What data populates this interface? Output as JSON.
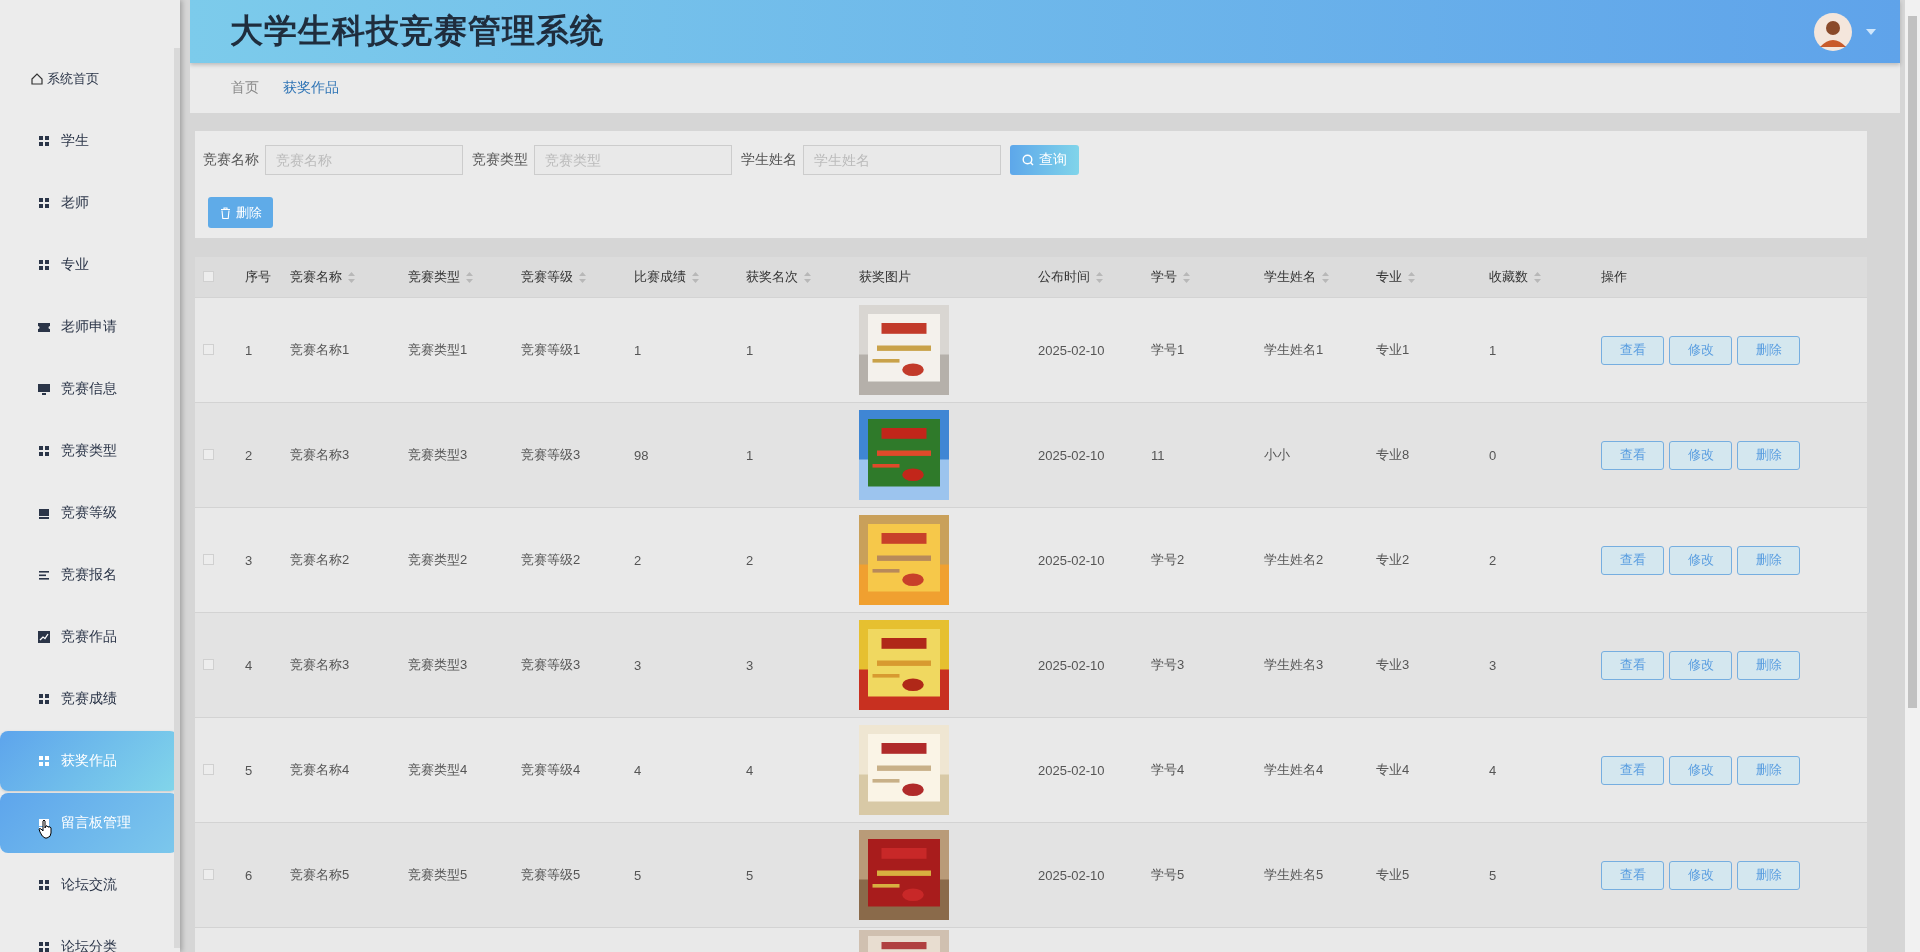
{
  "sidebar": {
    "items": [
      {
        "label": "系统首页",
        "selected": false,
        "hovered": false
      },
      {
        "label": "学生",
        "selected": false,
        "hovered": false
      },
      {
        "label": "老师",
        "selected": false,
        "hovered": false
      },
      {
        "label": "专业",
        "selected": false,
        "hovered": false
      },
      {
        "label": "老师申请",
        "selected": false,
        "hovered": false
      },
      {
        "label": "竞赛信息",
        "selected": false,
        "hovered": false
      },
      {
        "label": "竞赛类型",
        "selected": false,
        "hovered": false
      },
      {
        "label": "竞赛等级",
        "selected": false,
        "hovered": false
      },
      {
        "label": "竞赛报名",
        "selected": false,
        "hovered": false
      },
      {
        "label": "竞赛作品",
        "selected": false,
        "hovered": false
      },
      {
        "label": "竞赛成绩",
        "selected": false,
        "hovered": false
      },
      {
        "label": "获奖作品",
        "selected": true,
        "hovered": false
      },
      {
        "label": "留言板管理",
        "selected": false,
        "hovered": true
      },
      {
        "label": "论坛交流",
        "selected": false,
        "hovered": false
      },
      {
        "label": "论坛分类",
        "selected": false,
        "hovered": false
      }
    ]
  },
  "header": {
    "title": "大学生科技竞赛管理系统"
  },
  "breadcrumb": [
    {
      "label": "首页",
      "selected": false
    },
    {
      "label": "获奖作品",
      "selected": true
    }
  ],
  "search": {
    "fields": [
      {
        "label": "竞赛名称",
        "placeholder": "竞赛名称"
      },
      {
        "label": "竞赛类型",
        "placeholder": "竞赛类型"
      },
      {
        "label": "学生姓名",
        "placeholder": "学生姓名"
      }
    ],
    "query_button": "查询",
    "delete_button": "删除"
  },
  "table": {
    "header_checked": false,
    "columns": [
      {
        "label": "序号",
        "sortable": false
      },
      {
        "label": "竞赛名称",
        "sortable": true
      },
      {
        "label": "竞赛类型",
        "sortable": true
      },
      {
        "label": "竞赛等级",
        "sortable": true
      },
      {
        "label": "比赛成绩",
        "sortable": true
      },
      {
        "label": "获奖名次",
        "sortable": true
      },
      {
        "label": "获奖图片",
        "sortable": false
      },
      {
        "label": "公布时间",
        "sortable": true
      },
      {
        "label": "学号",
        "sortable": true
      },
      {
        "label": "学生姓名",
        "sortable": true
      },
      {
        "label": "专业",
        "sortable": true
      },
      {
        "label": "收藏数",
        "sortable": true
      },
      {
        "label": "操作",
        "sortable": false
      }
    ],
    "rows": [
      {
        "checked": false,
        "cells": [
          "1",
          "竞赛名称1",
          "竞赛类型1",
          "竞赛等级1",
          "1",
          "1"
        ],
        "picture": {
          "kind": "picture"
        },
        "rest": [
          "2025-02-10",
          "学号1",
          "学生姓名1",
          "专业1",
          "1"
        ],
        "actions": [
          "查看",
          "修改",
          "删除"
        ]
      },
      {
        "checked": false,
        "cells": [
          "2",
          "竞赛名称3",
          "竞赛类型3",
          "竞赛等级3",
          "98",
          "1"
        ],
        "picture": {
          "kind": "picture"
        },
        "rest": [
          "2025-02-10",
          "11",
          "小小",
          "专业8",
          "0"
        ],
        "actions": [
          "查看",
          "修改",
          "删除"
        ]
      },
      {
        "checked": false,
        "cells": [
          "3",
          "竞赛名称2",
          "竞赛类型2",
          "竞赛等级2",
          "2",
          "2"
        ],
        "picture": {
          "kind": "picture"
        },
        "rest": [
          "2025-02-10",
          "学号2",
          "学生姓名2",
          "专业2",
          "2"
        ],
        "actions": [
          "查看",
          "修改",
          "删除"
        ]
      },
      {
        "checked": false,
        "cells": [
          "4",
          "竞赛名称3",
          "竞赛类型3",
          "竞赛等级3",
          "3",
          "3"
        ],
        "picture": {
          "kind": "picture"
        },
        "rest": [
          "2025-02-10",
          "学号3",
          "学生姓名3",
          "专业3",
          "3"
        ],
        "actions": [
          "查看",
          "修改",
          "删除"
        ]
      },
      {
        "checked": false,
        "cells": [
          "5",
          "竞赛名称4",
          "竞赛类型4",
          "竞赛等级4",
          "4",
          "4"
        ],
        "picture": {
          "kind": "picture"
        },
        "rest": [
          "2025-02-10",
          "学号4",
          "学生姓名4",
          "专业4",
          "4"
        ],
        "actions": [
          "查看",
          "修改",
          "删除"
        ]
      },
      {
        "checked": false,
        "cells": [
          "6",
          "竞赛名称5",
          "竞赛类型5",
          "竞赛等级5",
          "5",
          "5"
        ],
        "picture": {
          "kind": "picture"
        },
        "rest": [
          "2025-02-10",
          "学号5",
          "学生姓名5",
          "专业5",
          "5"
        ],
        "actions": [
          "查看",
          "修改",
          "删除"
        ]
      }
    ],
    "partial_row": {
      "picture": {
        "kind": "picture"
      }
    }
  }
}
